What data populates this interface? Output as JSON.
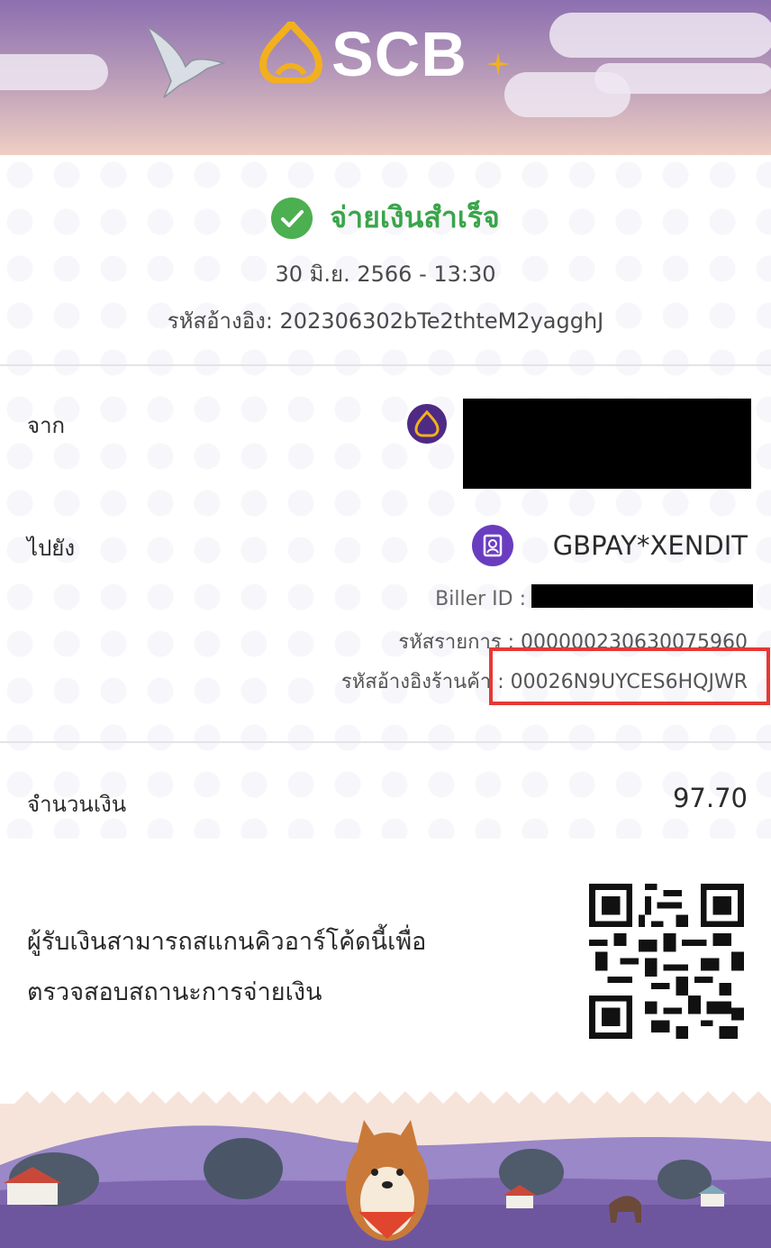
{
  "header": {
    "brand": "SCB",
    "logo_icon": "scb-lotus-icon",
    "colors": {
      "header_top": "#8c6fb0",
      "header_bottom": "#efcfc4",
      "logo_gold": "#f2b01e"
    }
  },
  "status": {
    "icon": "check-circle-icon",
    "text": "จ่ายเงินสำเร็จ",
    "color": "#3aa54a",
    "datetime": "30 มิ.ย. 2566 - 13:30",
    "reference": "รหัสอ้างอิง: 202306302bTe2thteM2yagghJ"
  },
  "from": {
    "label": "จาก",
    "icon": "scb-bank-icon"
  },
  "to": {
    "label": "ไปยัง",
    "icon": "biller-icon",
    "name": "GBPAY*XENDIT",
    "biller_id_label": "Biller ID :",
    "transaction_label": "รหัสรายการ : 000000230630075960",
    "merchant_ref_label": "รหัสอ้างอิงร้านค้า : 00026N9UYCES6HQJWR"
  },
  "amount": {
    "label": "จำนวนเงิน",
    "value": "97.70"
  },
  "qr": {
    "line1": "ผู้รับเงินสามารถสแกนคิวอาร์โค้ดนี้เพื่อ",
    "line2": "ตรวจสอบสถานะการจ่ายเงิน",
    "icon": "qr-code-icon"
  },
  "footer": {
    "illustration": "shiba-dog-landscape-illustration"
  }
}
